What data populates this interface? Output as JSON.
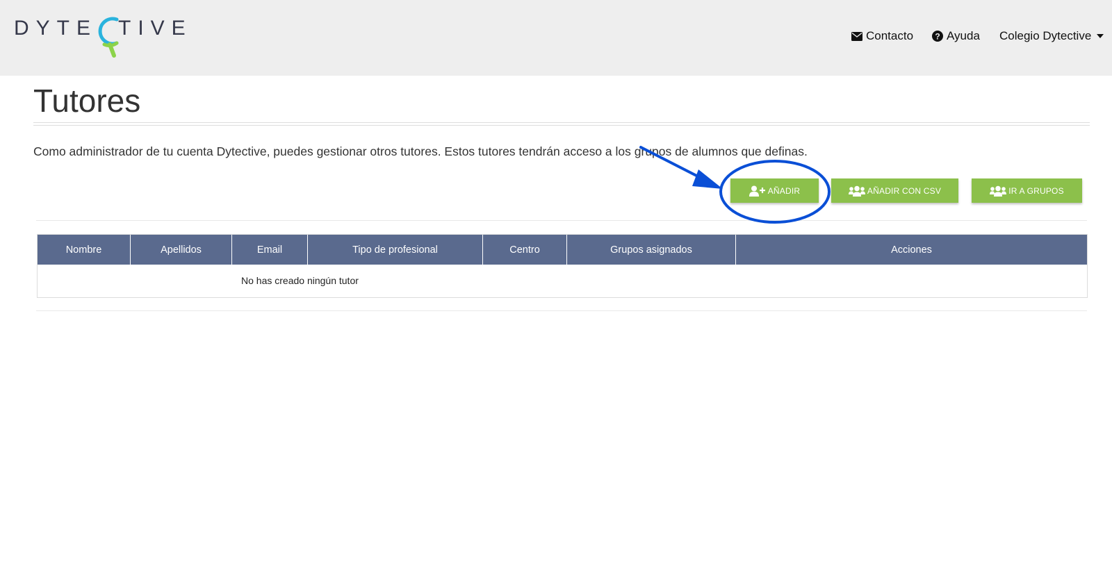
{
  "brand": {
    "logo_left": "DYTE",
    "logo_right": "TIVE",
    "colors": {
      "logo_text": "#35384a",
      "logo_blue": "#2ab3dd",
      "logo_green": "#8cd34a"
    }
  },
  "nav": {
    "contact_label": "Contacto",
    "help_label": "Ayuda",
    "account_label": "Colegio Dytective"
  },
  "page": {
    "title": "Tutores",
    "intro": "Como administrador de tu cuenta Dytective, puedes gestionar otros tutores. Estos tutores tendrán acceso a los grupos de alumnos que definas."
  },
  "actions": {
    "add_label": "AÑADIR",
    "add_csv_label": "AÑADIR CON CSV",
    "groups_label": "IR A GRUPOS"
  },
  "table": {
    "columns": [
      "Nombre",
      "Apellidos",
      "Email",
      "Tipo de profesional",
      "Centro",
      "Grupos asignados",
      "Acciones"
    ],
    "empty_message": "No has creado ningún tutor"
  },
  "colors": {
    "topbar": "#eeeeee",
    "button_green": "#8cc04b",
    "table_header": "#5a6a8e",
    "annotation_blue": "#0a4fd6"
  },
  "icons": [
    "envelope-icon",
    "question-circle-icon",
    "user-plus-icon",
    "users-icon",
    "caret-down-icon"
  ]
}
